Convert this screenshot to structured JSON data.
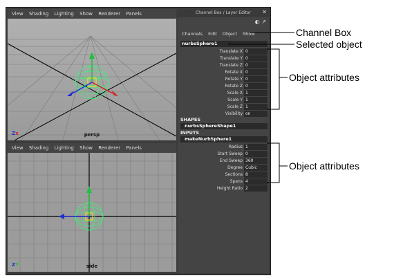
{
  "viewport_menu": [
    "View",
    "Shading",
    "Lighting",
    "Show",
    "Renderer",
    "Panels"
  ],
  "top_view": {
    "camera": "persp"
  },
  "bottom_view": {
    "camera": "side"
  },
  "channel_box": {
    "title": "Channel Box / Layer Editor",
    "menu": [
      "Channels",
      "Edit",
      "Object",
      "Show"
    ],
    "object": "nurbsSphere1",
    "transform_attrs": [
      {
        "label": "Translate X",
        "value": "0"
      },
      {
        "label": "Translate Y",
        "value": "0"
      },
      {
        "label": "Translate Z",
        "value": "0"
      },
      {
        "label": "Rotate X",
        "value": "0"
      },
      {
        "label": "Rotate Y",
        "value": "0"
      },
      {
        "label": "Rotate Z",
        "value": "0"
      },
      {
        "label": "Scale X",
        "value": "1"
      },
      {
        "label": "Scale Y",
        "value": "1"
      },
      {
        "label": "Scale Z",
        "value": "1"
      },
      {
        "label": "Visibility",
        "value": "on"
      }
    ],
    "shapes_header": "SHAPES",
    "shape_name": "nurbsSphereShape1",
    "inputs_header": "INPUTS",
    "input_name": "makeNurbSphere1",
    "input_attrs": [
      {
        "label": "Radius",
        "value": "1"
      },
      {
        "label": "Start Sweep",
        "value": "0"
      },
      {
        "label": "End Sweep",
        "value": "360"
      },
      {
        "label": "Degree",
        "value": "Cubic"
      },
      {
        "label": "Sections",
        "value": "8"
      },
      {
        "label": "Spans",
        "value": "4"
      },
      {
        "label": "Height Ratio",
        "value": "2"
      }
    ]
  },
  "annotations": {
    "channel_box": "Channel Box",
    "selected_object": "Selected object",
    "object_attributes_1": "Object attributes",
    "object_attributes_2": "Object attributes"
  },
  "colors": {
    "accent_green": "#3ef07a",
    "axis_red": "#d02020",
    "axis_blue": "#2030d0",
    "axis_green": "#20c040"
  }
}
